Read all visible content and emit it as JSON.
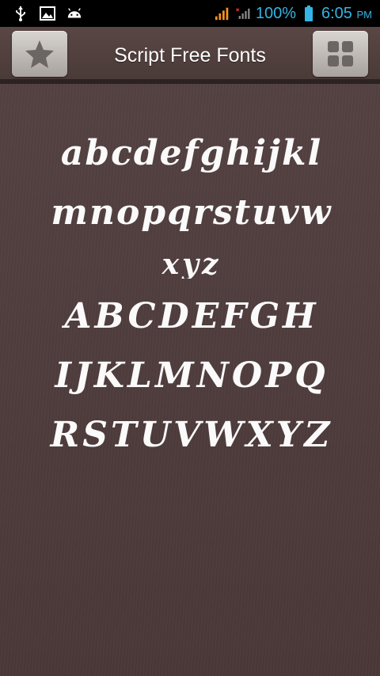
{
  "status_bar": {
    "battery_percent": "100%",
    "time": "6:05",
    "ampm": "PM",
    "accent": "#33b5e5",
    "signal_color": "#f7931e"
  },
  "action_bar": {
    "title": "Script Free Fonts",
    "left_button_icon": "star-icon",
    "right_button_icon": "grid-icon"
  },
  "preview": {
    "lines": [
      "abcdefghijkl",
      "mnopqrstuvw",
      "xyz",
      "ABCDEFGH",
      "IJKLMNOPQ",
      "RSTUVWXYZ"
    ],
    "text_color": "#fafafa"
  }
}
